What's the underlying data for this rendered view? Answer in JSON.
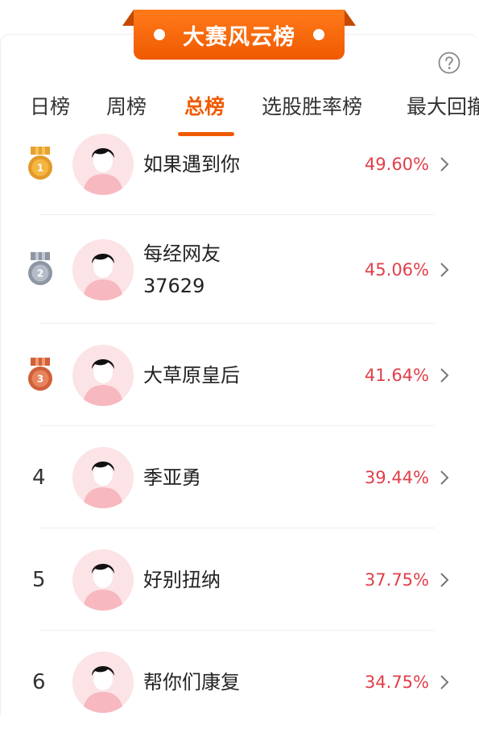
{
  "header": {
    "title": "大赛风云榜"
  },
  "help": {
    "icon": "help-circle-icon"
  },
  "tabs": [
    {
      "label": "日榜",
      "active": false
    },
    {
      "label": "周榜",
      "active": false
    },
    {
      "label": "总榜",
      "active": true
    },
    {
      "label": "选股胜率榜",
      "active": false
    },
    {
      "label": "最大回撤",
      "active": false
    }
  ],
  "leaderboard": [
    {
      "rank": "1",
      "medal": "gold-medal-icon",
      "name": "如果遇到你",
      "rate": "49.60%"
    },
    {
      "rank": "2",
      "medal": "silver-medal-icon",
      "name_line1": "每经网友",
      "name_line2": "37629",
      "rate": "45.06%"
    },
    {
      "rank": "3",
      "medal": "bronze-medal-icon",
      "name": "大草原皇后",
      "rate": "41.64%"
    },
    {
      "rank": "4",
      "name": "季亚勇",
      "rate": "39.44%"
    },
    {
      "rank": "5",
      "name": "好别扭纳",
      "rate": "37.75%"
    },
    {
      "rank": "6",
      "name": "帮你们康复",
      "rate": "34.75%"
    }
  ],
  "colors": {
    "accent": "#f05a00",
    "rate": "#e0404a",
    "gold": "#e29a2a",
    "silver": "#8e96a4",
    "bronze": "#d0603a"
  }
}
